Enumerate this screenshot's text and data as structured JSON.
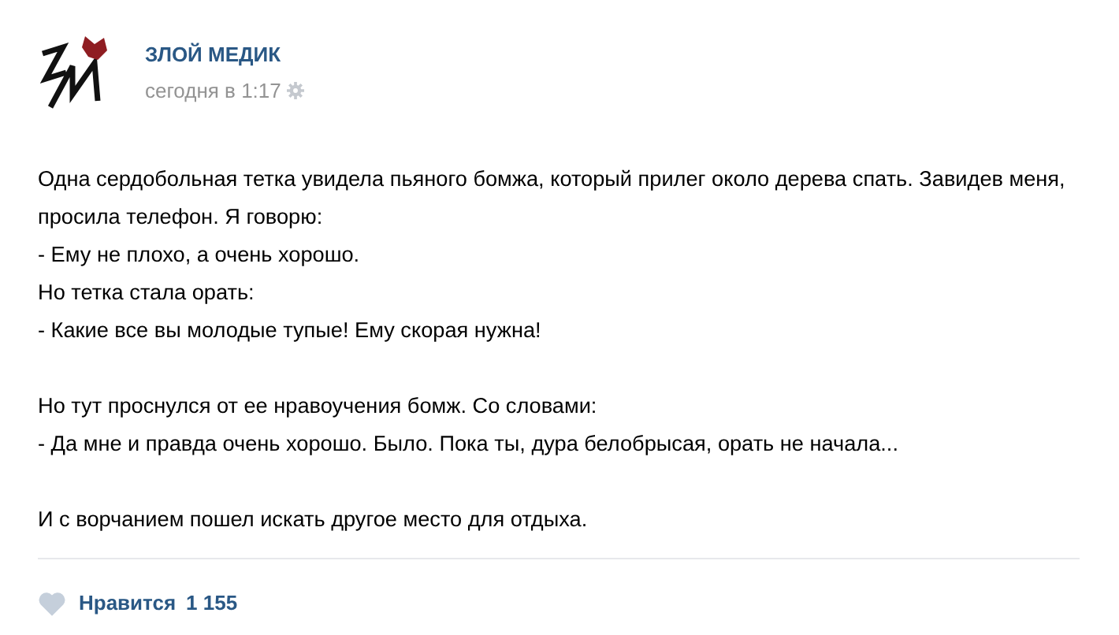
{
  "author": {
    "name": "ЗЛОЙ МЕДИК",
    "time": "сегодня в 1:17"
  },
  "paragraphs": [
    [
      "Одна сердобольная тетка увидела пьяного бомжа, который прилег около дерева спать. Завидев меня, просила телефон. Я говорю:",
      "- Ему не плохо, а очень хорошо.",
      "Но тетка стала орать:",
      "- Какие все вы молодые тупые! Ему скорая нужна!"
    ],
    [
      "Но тут проснулся от ее нравоучения бомж. Со словами:",
      "- Да мне и правда очень хорошо. Было. Пока ты, дура белобрысая, орать не начала..."
    ],
    [
      "И с ворчанием пошел искать другое место для отдыха."
    ]
  ],
  "like": {
    "label": "Нравится",
    "count": "1 155",
    "liked": false
  }
}
